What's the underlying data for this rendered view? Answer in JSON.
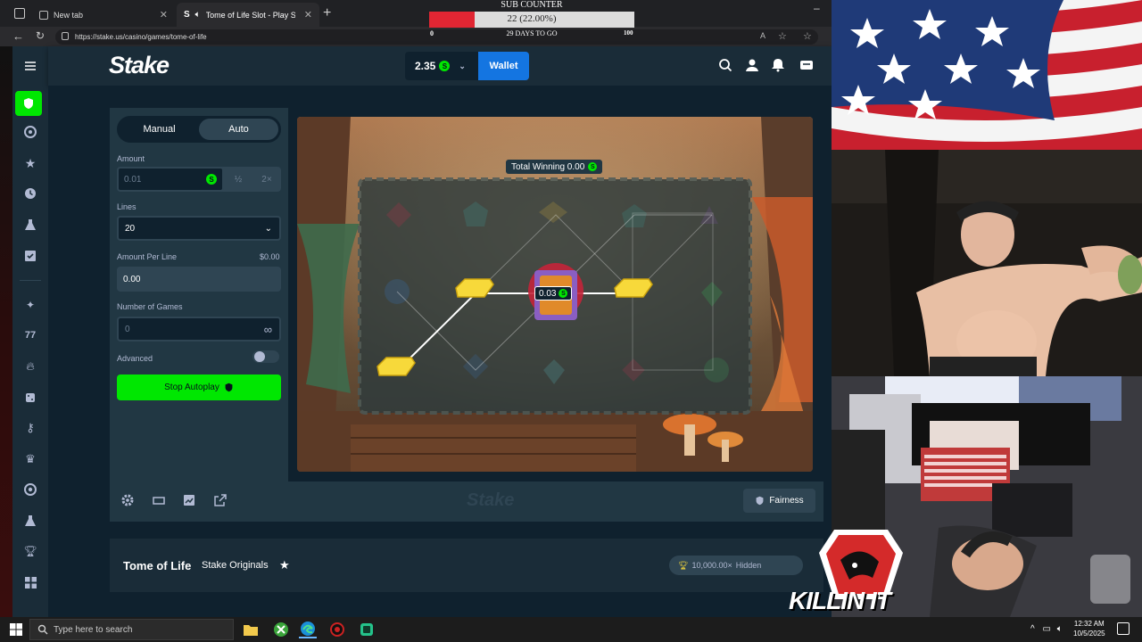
{
  "browser": {
    "tabs": [
      {
        "label": "New tab",
        "active": false
      },
      {
        "label": "Tome of Life Slot - Play Stak…",
        "active": true
      }
    ],
    "url": "https://stake.us/casino/games/tome-of-life"
  },
  "sub_counter": {
    "title": "SUB COUNTER",
    "value_text": "22 (22.00%)",
    "progress_fraction": 0.22,
    "min_label": "0",
    "max_label": "100",
    "days_label": "29 DAYS TO GO"
  },
  "header": {
    "logo": "Stake",
    "balance": "2.35",
    "wallet_label": "Wallet"
  },
  "bet_panel": {
    "tab_manual": "Manual",
    "tab_auto": "Auto",
    "amount_label": "Amount",
    "amount_value": "0.01",
    "half_label": "½",
    "double_label": "2×",
    "lines_label": "Lines",
    "lines_value": "20",
    "per_line_label": "Amount Per Line",
    "per_line_amount": "$0.00",
    "per_line_value": "0.00",
    "games_label": "Number of Games",
    "games_value": "0",
    "games_infinity": "∞",
    "advanced_label": "Advanced",
    "stop_label": "Stop Autoplay"
  },
  "game": {
    "total_winning_label": "Total Winning 0.00",
    "win_bubble": "0.03",
    "watermark": "Stake"
  },
  "bottom": {
    "fairness_label": "Fairness"
  },
  "info": {
    "title": "Tome of Life",
    "provider": "Stake Originals",
    "max_win": "10,000.00×",
    "hidden": "Hidden"
  },
  "overlay": {
    "brand": "KILLIN IT"
  },
  "taskbar": {
    "search_placeholder": "Type here to search",
    "time": "12:32 AM",
    "date": "10/5/2025"
  },
  "colors": {
    "accent_green": "#00e701",
    "wallet_blue": "#1475e1",
    "bg": "#0f212e"
  }
}
